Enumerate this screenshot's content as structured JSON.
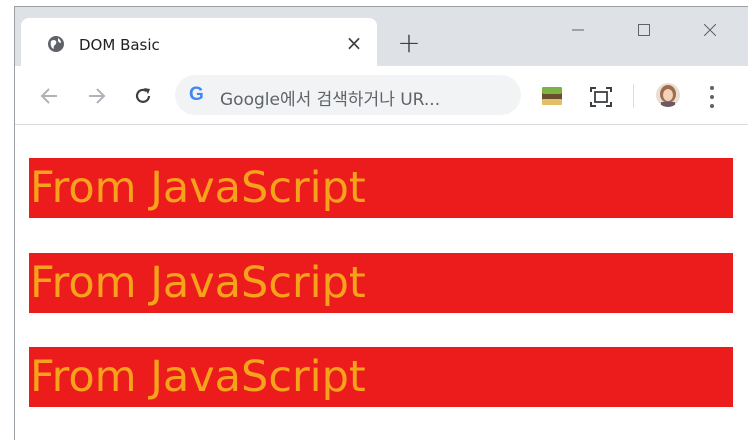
{
  "tab": {
    "title": "DOM Basic",
    "close_glyph": "×",
    "favicon": "globe-icon"
  },
  "new_tab_glyph": "+",
  "window_controls": [
    "minimize-icon",
    "maximize-icon",
    "close-icon"
  ],
  "toolbar": {
    "back": "back-arrow-icon",
    "forward": "forward-arrow-icon",
    "reload": "reload-icon",
    "google_letter": "G",
    "omnibox_placeholder": "Google에서 검색하거나 UR...",
    "extensions": [
      "extension-icon",
      "screen-capture-icon"
    ],
    "profile": "profile-avatar",
    "menu": "more-menu-icon"
  },
  "content": {
    "lines": [
      "From JavaScript",
      "From JavaScript",
      "From JavaScript"
    ]
  },
  "colors": {
    "line_background": "#ec1c1c",
    "line_text": "#f7a21b",
    "tabstrip": "#dee1e6",
    "omnibox": "#f1f3f4"
  }
}
